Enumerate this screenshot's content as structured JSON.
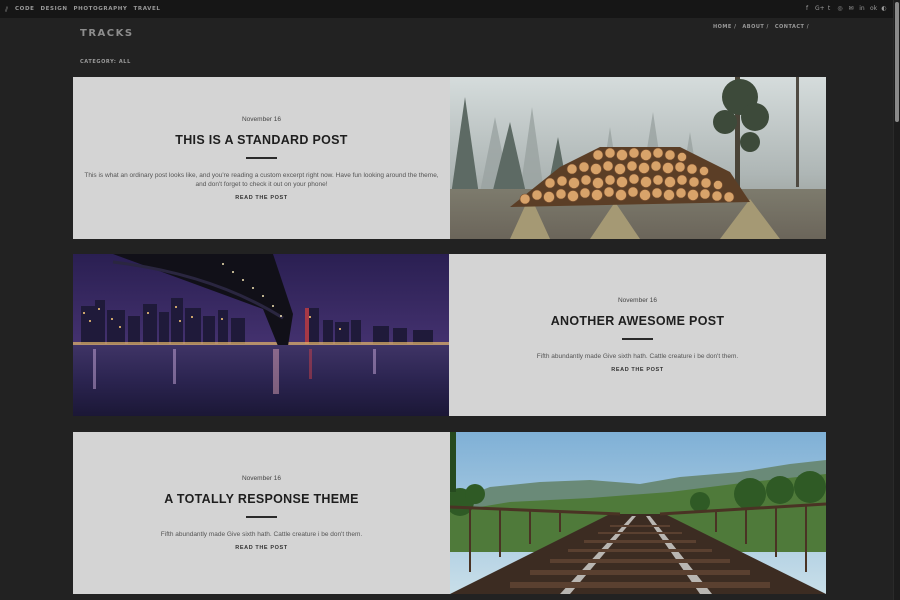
{
  "topbar": {
    "slashes": "//",
    "nav": [
      "CODE",
      "DESIGN",
      "PHOTOGRAPHY",
      "TRAVEL"
    ],
    "social_icons": [
      {
        "name": "facebook-icon",
        "glyph": "f"
      },
      {
        "name": "google-plus-icon",
        "glyph": "G+"
      },
      {
        "name": "twitter-icon",
        "glyph": "t"
      },
      {
        "name": "instagram-icon",
        "glyph": "◎"
      },
      {
        "name": "email-icon",
        "glyph": "✉"
      },
      {
        "name": "linkedin-icon",
        "glyph": "in"
      },
      {
        "name": "odnoklassniki-icon",
        "glyph": "ok"
      },
      {
        "name": "github-icon",
        "glyph": "◐"
      }
    ]
  },
  "header": {
    "site_title": "TRACKS",
    "nav": [
      "HOME /",
      "ABOUT /",
      "CONTACT /"
    ],
    "category": "CATEGORY: ALL"
  },
  "posts": [
    {
      "date": "November 16",
      "title": "THIS IS A STANDARD POST",
      "excerpt": "This is what an ordinary post looks like, and you're reading a custom excerpt right now. Have fun looking around the theme, and don't forget to check it out on your phone!",
      "link": "READ THE POST",
      "image": "forest-logs-image"
    },
    {
      "date": "November 16",
      "title": "ANOTHER AWESOME POST",
      "excerpt": "Fifth abundantly made Give sixth hath. Cattle creature i be don't them.",
      "link": "READ THE POST",
      "image": "city-bridge-image"
    },
    {
      "date": "November 16",
      "title": "A TOTALLY RESPONSE THEME",
      "excerpt": "Fifth abundantly made Give sixth hath. Cattle creature i be don't them.",
      "link": "READ THE POST",
      "image": "railway-tracks-image"
    }
  ]
}
